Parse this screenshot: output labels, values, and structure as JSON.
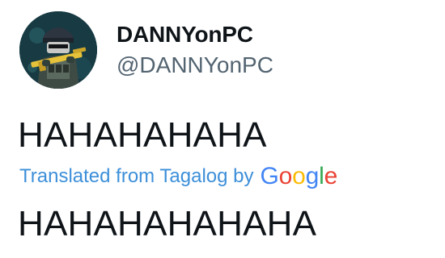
{
  "tweet": {
    "author": {
      "display_name": "DANNYonPC",
      "handle": "@DANNYonPC",
      "avatar_icon": "soldier-avatar"
    },
    "original_text": "HAHAHAHAHA",
    "translation": {
      "label": "Translated from Tagalog by",
      "provider_logo_text": "Google",
      "text": "HAHAHAHAHAHA"
    }
  },
  "colors": {
    "link_blue": "#3d8fd9",
    "secondary_text": "#536471",
    "primary_text": "#0f1419",
    "google_blue": "#4285F4",
    "google_red": "#EA4335",
    "google_yellow": "#FBBC05",
    "google_green": "#34A853"
  }
}
